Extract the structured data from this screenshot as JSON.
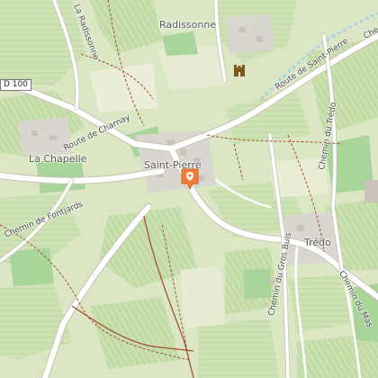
{
  "map": {
    "places": {
      "radissonne": "Radissonne",
      "la_chapelle": "La Chapelle",
      "saint_pierre": "Saint-Pierre",
      "tredo": "Trédo"
    },
    "roads": {
      "route_saint_pierre": "Route de Saint-Pierre",
      "route_charnay": "Route de Charnay",
      "la_radissonne": "La Radissonne",
      "chemin_tredo": "Chemin du Trédo",
      "chemin_fontjards": "Chemin de Fontjards",
      "chemin_gros_buis": "Chemin du Gros Buis",
      "chemin_mas": "Chemin du Mas",
      "che_fragment": "Che"
    },
    "road_shield": "D 100",
    "colors": {
      "vineyard": "#cfe2b5",
      "field": "#e6ebd2",
      "woodland": "#a9d59a",
      "road": "#ffffff",
      "road_casing": "#c9c2b6",
      "path": "#a0522d",
      "river": "#aad3df",
      "marker": "#f07c3a"
    },
    "icons": {
      "marker": "location-pin-icon",
      "castle": "castle-icon"
    }
  }
}
